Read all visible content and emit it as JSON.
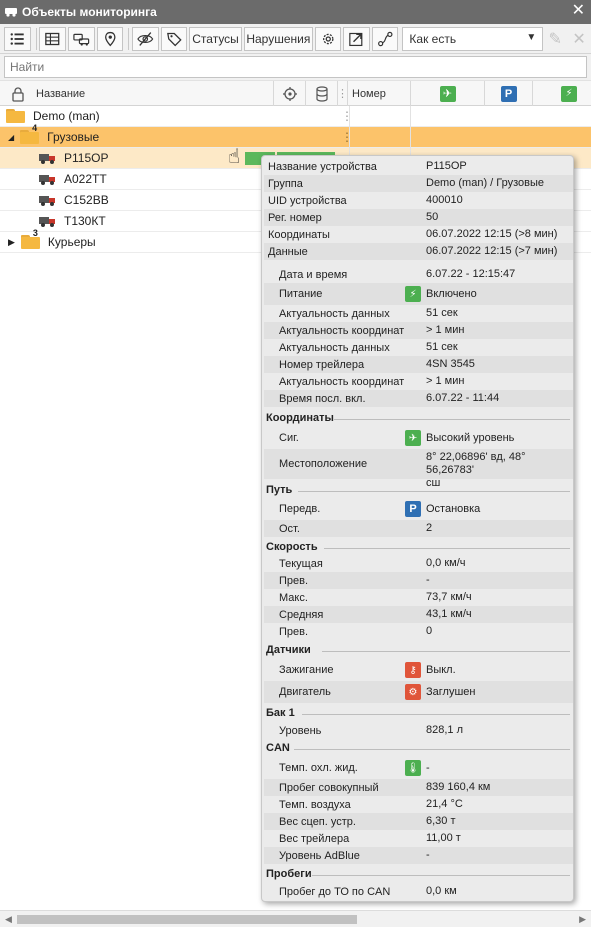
{
  "window": {
    "title": "Объекты мониторинга"
  },
  "toolbar": {
    "statuses_label": "Статусы",
    "violations_label": "Нарушения",
    "dropdown_value": "Как есть"
  },
  "search": {
    "placeholder": "Найти"
  },
  "columns": {
    "name": "Название",
    "number": "Номер"
  },
  "tree": {
    "root": "Demo (man)",
    "group1": {
      "label": "Грузовые",
      "count": "4"
    },
    "vehicles": [
      "Р115ОР",
      "А022ТТ",
      "С152ВВ",
      "Т130КТ"
    ],
    "group2": {
      "label": "Курьеры",
      "count": "3"
    }
  },
  "tooltip": {
    "top": [
      {
        "label": "Название устройства",
        "value": "Р115ОР"
      },
      {
        "label": "Группа",
        "value": "Demo (man) / Грузовые"
      },
      {
        "label": "UID устройства",
        "value": "400010"
      },
      {
        "label": "Рег. номер",
        "value": "50"
      },
      {
        "label": "Координаты",
        "value": "06.07.2022 12:15 (>8 мин)"
      },
      {
        "label": "Данные",
        "value": "06.07.2022 12:15 (>7 мин)"
      }
    ],
    "info": [
      {
        "label": "Дата и время",
        "value": "6.07.22 - 12:15:47"
      },
      {
        "label": "Питание",
        "value": "Включено",
        "icon": "power-plug-icon"
      },
      {
        "label": "Актуальность данных",
        "value": "51 сек"
      },
      {
        "label": "Актуальность координат",
        "value": "> 1 мин"
      },
      {
        "label": "Актуальность данных",
        "value": "51 сек"
      },
      {
        "label": "Номер трейлера",
        "value": "4SN 3545"
      },
      {
        "label": "Актуальность координат",
        "value": "> 1 мин"
      },
      {
        "label": "Время посл. вкл.",
        "value": "6.07.22 - 11:44"
      }
    ],
    "coords": {
      "title": "Координаты",
      "signal": {
        "label": "Сиг.",
        "value": "Высокий уровень"
      },
      "location": {
        "label": "Местоположение",
        "value_line1": "8° 22,06896' вд, 48° 56,26783'",
        "value_line2": "сш"
      }
    },
    "route": {
      "title": "Путь",
      "move": {
        "label": "Передв.",
        "value": "Остановка"
      },
      "stops": {
        "label": "Ост.",
        "value": "2"
      }
    },
    "speed": {
      "title": "Скорость",
      "rows": [
        {
          "label": "Текущая",
          "value": "0,0 км/ч"
        },
        {
          "label": "Прев.",
          "value": "-"
        },
        {
          "label": "Макс.",
          "value": "73,7 км/ч"
        },
        {
          "label": "Средняя",
          "value": "43,1 км/ч"
        },
        {
          "label": "Прев.",
          "value": "0"
        }
      ]
    },
    "sensors": {
      "title": "Датчики",
      "ignition": {
        "label": "Зажигание",
        "value": "Выкл."
      },
      "engine": {
        "label": "Двигатель",
        "value": "Заглушен"
      }
    },
    "tank": {
      "title": "Бак 1",
      "level": {
        "label": "Уровень",
        "value": "828,1 л"
      }
    },
    "can": {
      "title": "CAN",
      "rows": [
        {
          "label": "Темп. охл. жид.",
          "value": "-"
        },
        {
          "label": "Пробег совокупный",
          "value": "839 160,4 км"
        },
        {
          "label": "Темп. воздуха",
          "value": "21,4 °C"
        },
        {
          "label": "Вес сцеп. устр.",
          "value": "6,30 т"
        },
        {
          "label": "Вес трейлера",
          "value": "11,00 т"
        },
        {
          "label": "Уровень AdBlue",
          "value": "-"
        }
      ]
    },
    "mileage": {
      "title": "Пробеги",
      "to": {
        "label": "Пробег до ТО по CAN",
        "value": "0,0 км"
      }
    }
  },
  "colors": {
    "selected_row": "#fcc36a",
    "green_icon": "#4caf50",
    "blue_icon": "#2f6fb3",
    "red_icon": "#e0553a"
  }
}
